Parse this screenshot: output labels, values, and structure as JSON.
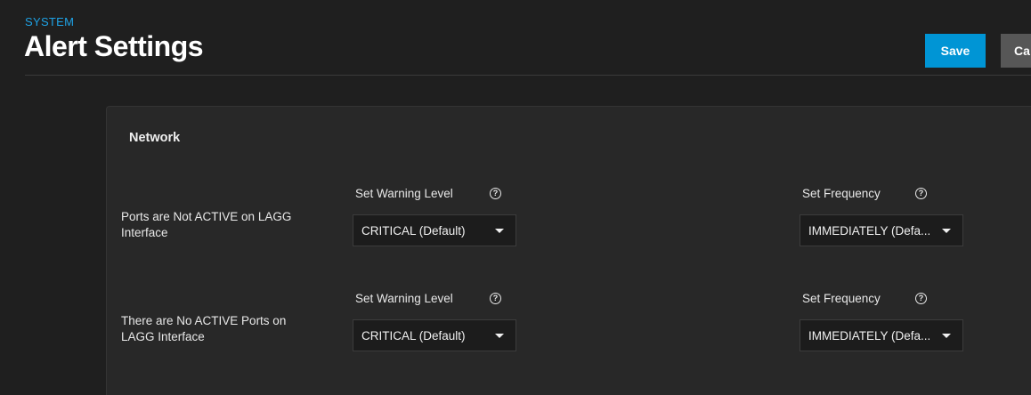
{
  "header": {
    "breadcrumb": "SYSTEM",
    "title": "Alert Settings",
    "save_label": "Save",
    "cancel_label": "Ca"
  },
  "section": {
    "title": "Network"
  },
  "alerts": [
    {
      "name": "Ports are Not ACTIVE on LAGG Interface",
      "warning_label": "Set Warning Level",
      "warning_value": "CRITICAL (Default)",
      "frequency_label": "Set Frequency",
      "frequency_value": "IMMEDIATELY (Defa..."
    },
    {
      "name": "There are No ACTIVE Ports on LAGG Interface",
      "warning_label": "Set Warning Level",
      "warning_value": "CRITICAL (Default)",
      "frequency_label": "Set Frequency",
      "frequency_value": "IMMEDIATELY (Defa..."
    }
  ],
  "icons": {
    "help": "?"
  },
  "colors": {
    "accent": "#0095d5",
    "breadcrumb": "#1ea2e5",
    "background": "#1f1f1f",
    "card": "#282828"
  }
}
